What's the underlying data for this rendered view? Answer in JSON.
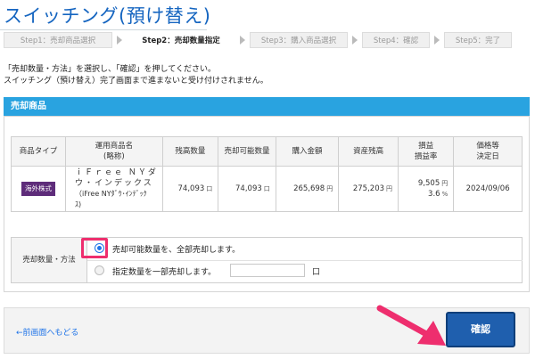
{
  "page": {
    "title": "スイッチング(預け替え)"
  },
  "steps": [
    {
      "label": "Step1：売却商品選択"
    },
    {
      "label": "Step2：売却数量指定"
    },
    {
      "label": "Step3：購入商品選択"
    },
    {
      "label": "Step4：確認"
    },
    {
      "label": "Step5：完了"
    }
  ],
  "intro": {
    "line1": "「売却数量・方法」を選択し、「確認」を押してください。",
    "line2": "スイッチング（預け替え）完了画面まで進まないと受け付けされません。"
  },
  "section": {
    "title": "売却商品"
  },
  "table": {
    "headers": {
      "type": "商品タイプ",
      "name_1": "運用商品名",
      "name_2": "(略称)",
      "balance": "残高数量",
      "sellable": "売却可能数量",
      "purchase": "購入金額",
      "asset": "資産残高",
      "pl_1": "損益",
      "pl_2": "損益率",
      "price_1": "価格等",
      "price_2": "決定日"
    },
    "row": {
      "type_badge": "海外株式",
      "name_1": "ｉＦｒｅｅ ＮＹダ",
      "name_2": "ウ・インデックス",
      "name_3": "（iFree NYﾀﾞｳ･ｲﾝﾃﾞｯｸ",
      "name_4": "ｽ)",
      "balance": "74,093",
      "balance_unit": "口",
      "sellable": "74,093",
      "sellable_unit": "口",
      "purchase": "265,698",
      "purchase_unit": "円",
      "asset": "275,203",
      "asset_unit": "円",
      "pl": "9,505",
      "pl_unit": "円",
      "pl_rate": "3.6",
      "pl_rate_unit": "%",
      "price_date": "2024/09/06"
    }
  },
  "method": {
    "label": "売却数量・方法",
    "option_all": "売却可能数量を、全部売却します。",
    "option_partial": "指定数量を一部売却します。",
    "qty_value": "",
    "qty_unit": "口",
    "selected": "all"
  },
  "footer": {
    "back_label": "←前画面へもどる",
    "confirm_label": "確認"
  },
  "colors": {
    "title": "#1565c0",
    "section_bar": "#29a3e0",
    "badge": "#5e2c7a",
    "confirm_button": "#1f5fae",
    "highlight": "#ee2e6e"
  }
}
